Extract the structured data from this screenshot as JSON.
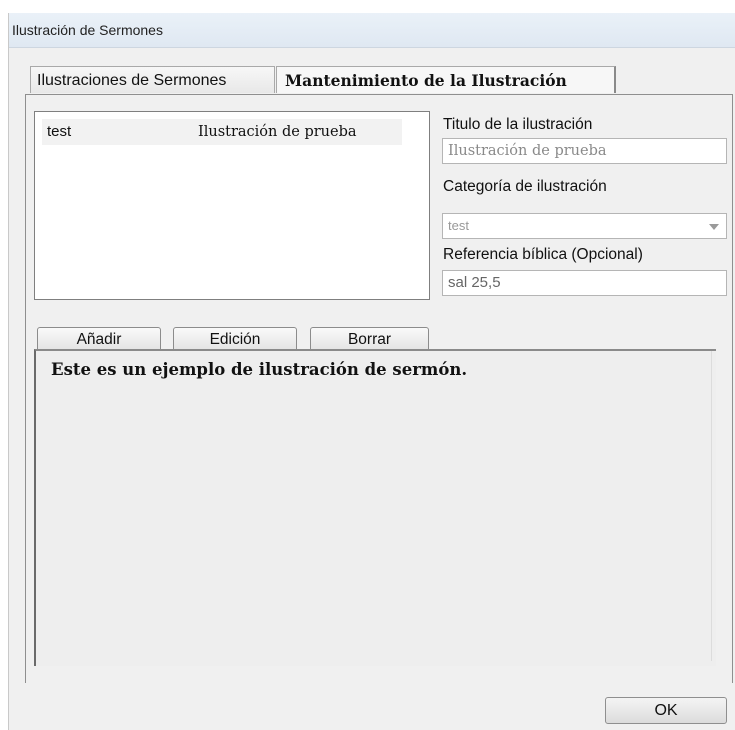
{
  "window": {
    "title": "Ilustración de Sermones"
  },
  "tabs": [
    {
      "label": "Ilustraciones de Sermones",
      "active": false
    },
    {
      "label": "Mantenimiento de la Ilustración",
      "active": true
    }
  ],
  "list": {
    "rows": [
      {
        "name": "test",
        "title": "Ilustración de prueba"
      }
    ]
  },
  "form": {
    "title_label": "Titulo de la ilustración",
    "title_value": "Ilustración de prueba",
    "category_label": "Categoría de ilustración",
    "category_value": "test",
    "reference_label": "Referencia bíblica (Opcional)",
    "reference_value": "sal 25,5"
  },
  "buttons": {
    "add": "Añadir",
    "edit": "Edición",
    "delete": "Borrar",
    "ok": "OK"
  },
  "editor": {
    "text": "Este es un ejemplo de ilustración de sermón."
  }
}
